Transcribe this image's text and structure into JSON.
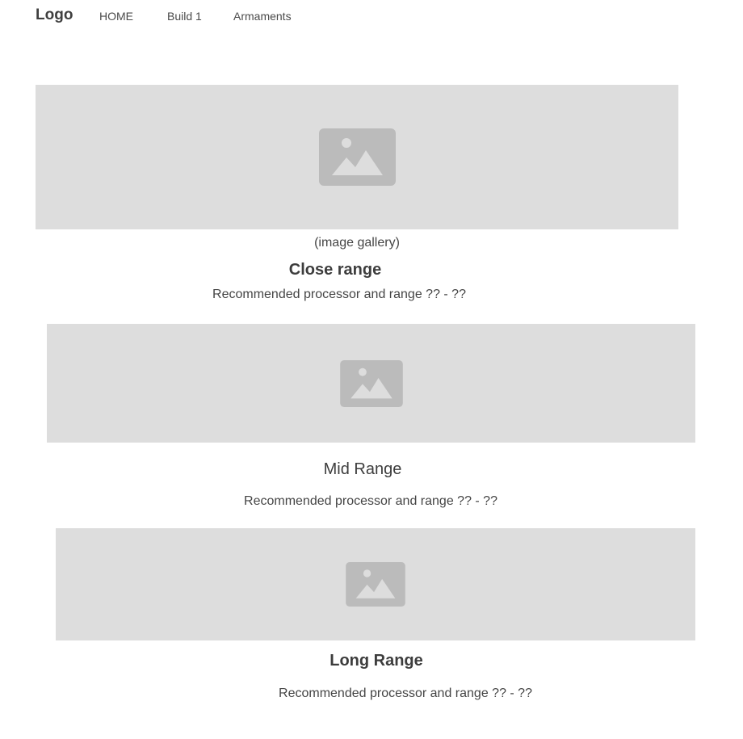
{
  "nav": {
    "logo": "Logo",
    "links": [
      "HOME",
      "Build 1",
      "Armaments"
    ]
  },
  "gallery": {
    "image_icon": "image-placeholder-icon",
    "caption": "(image gallery)"
  },
  "sections": [
    {
      "title": "Close range",
      "title_weight": "bold",
      "description": "Recommended processor and range ?? - ??",
      "image_icon": "image-placeholder-icon"
    },
    {
      "title": "Mid Range",
      "title_weight": "normal",
      "description": "Recommended processor and range ?? - ??",
      "image_icon": "image-placeholder-icon"
    },
    {
      "title": "Long Range",
      "title_weight": "bold",
      "description": "Recommended processor and range ?? - ??",
      "image_icon": "image-placeholder-icon"
    }
  ],
  "colors": {
    "placeholder_bg": "#dddddd",
    "placeholder_icon": "#bbbbbb",
    "text": "#444444"
  }
}
